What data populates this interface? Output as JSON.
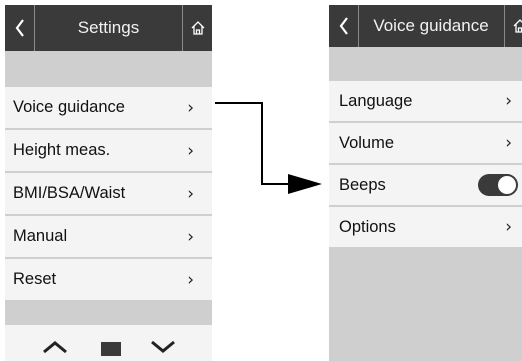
{
  "left_screen": {
    "title": "Settings",
    "items": [
      {
        "label": "Voice guidance"
      },
      {
        "label": "Height meas."
      },
      {
        "label": "BMI/BSA/Waist"
      },
      {
        "label": "Manual"
      },
      {
        "label": "Reset"
      }
    ]
  },
  "right_screen": {
    "title": "Voice guidance",
    "items": [
      {
        "label": "Language"
      },
      {
        "label": "Volume"
      },
      {
        "label": "Beeps",
        "toggle": "on"
      },
      {
        "label": "Options"
      }
    ]
  },
  "colors": {
    "titlebar": "#3a3a3a",
    "background": "#cfcfcf",
    "item": "#f4f4f4"
  },
  "icons": [
    "back-icon",
    "home-icon",
    "chevron-right-icon",
    "chevron-up-icon",
    "chevron-down-icon",
    "toggle-switch"
  ]
}
